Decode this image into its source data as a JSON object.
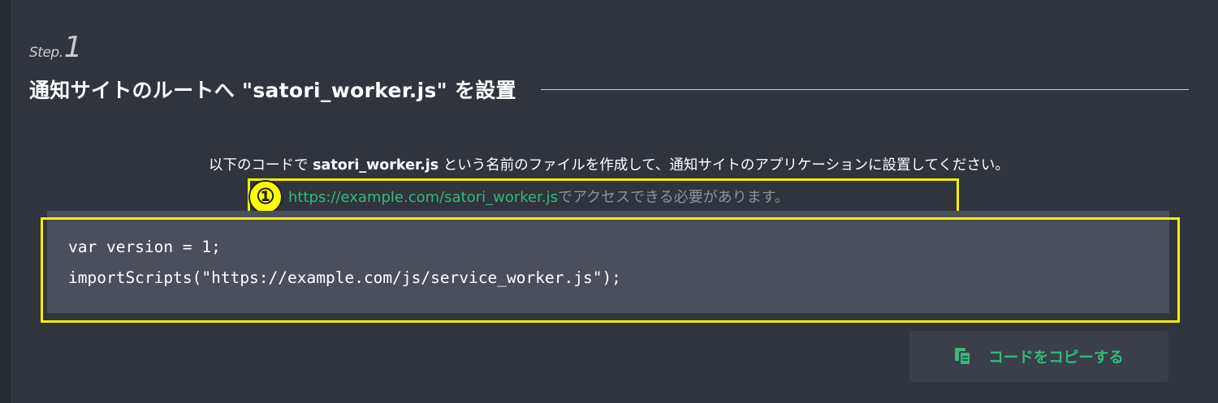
{
  "step": {
    "word": "Step.",
    "number": "1"
  },
  "heading": "通知サイトのルートへ \"satori_worker.js\" を設置",
  "description": {
    "before": "以下のコードで ",
    "filename": "satori_worker.js",
    "after": " という名前のファイルを作成して、通知サイトのアプリケーションに設置してください。"
  },
  "note": {
    "url": "https://example.com/satori_worker.js",
    "text": "でアクセスできる必要があります。"
  },
  "annotation_marker": "①",
  "code_lines": [
    "var version = 1;",
    "importScripts(\"https://example.com/js/service_worker.js\");"
  ],
  "copy_button": {
    "label": "コードをコピーする",
    "icon": "copy-icon"
  },
  "colors": {
    "background": "#2f343d",
    "accent_green": "#35b97a",
    "highlight_yellow": "#f5f000",
    "code_background": "#4b4f5b"
  }
}
